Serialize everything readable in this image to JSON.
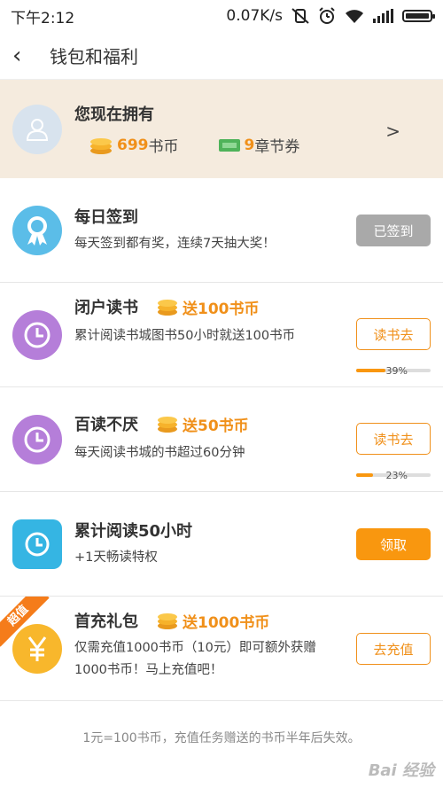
{
  "status_bar": {
    "time": "下午2:12",
    "speed": "0.07K/s"
  },
  "nav": {
    "title": "钱包和福利"
  },
  "wallet": {
    "title": "您现在拥有",
    "coins_value": "699",
    "coins_unit": "书币",
    "vouchers_value": "9",
    "vouchers_unit": "章节券",
    "arrow": ">"
  },
  "tasks": [
    {
      "title": "每日签到",
      "desc": "每天签到都有奖，连续7天抽大奖！",
      "button": "已签到"
    },
    {
      "title": "闭户读书",
      "reward": "送100书币",
      "desc": "累计阅读书城图书50小时就送100书币",
      "button": "读书去",
      "progress": 0.39,
      "progress_label": "39%"
    },
    {
      "title": "百读不厌",
      "reward": "送50书币",
      "desc": "每天阅读书城的书超过60分钟",
      "button": "读书去",
      "progress": 0.23,
      "progress_label": "23%"
    },
    {
      "title": "累计阅读50小时",
      "desc": "+1天畅读特权",
      "button": "领取"
    },
    {
      "title": "首充礼包",
      "reward": "送1000书币",
      "desc": "仅需充值1000书币（10元）即可额外获赠1000书币！马上充值吧！",
      "button": "去充值",
      "badge": "超值"
    }
  ],
  "footer": {
    "note": "1元=100书币，充值任务赠送的书币半年后失效。"
  },
  "watermark": "Bai 经验",
  "colors": {
    "accent": "#f0901a",
    "wallet_bg": "#f5ebde",
    "purple": "#b57ed9",
    "blue": "#5bbde8",
    "teal": "#35b5e3",
    "gold": "#f8b72c"
  },
  "icons": {
    "coin": "coin-stack-icon",
    "voucher": "voucher-ticket-icon",
    "medal": "medal-icon",
    "clock": "clock-icon",
    "yen": "yen-icon"
  }
}
